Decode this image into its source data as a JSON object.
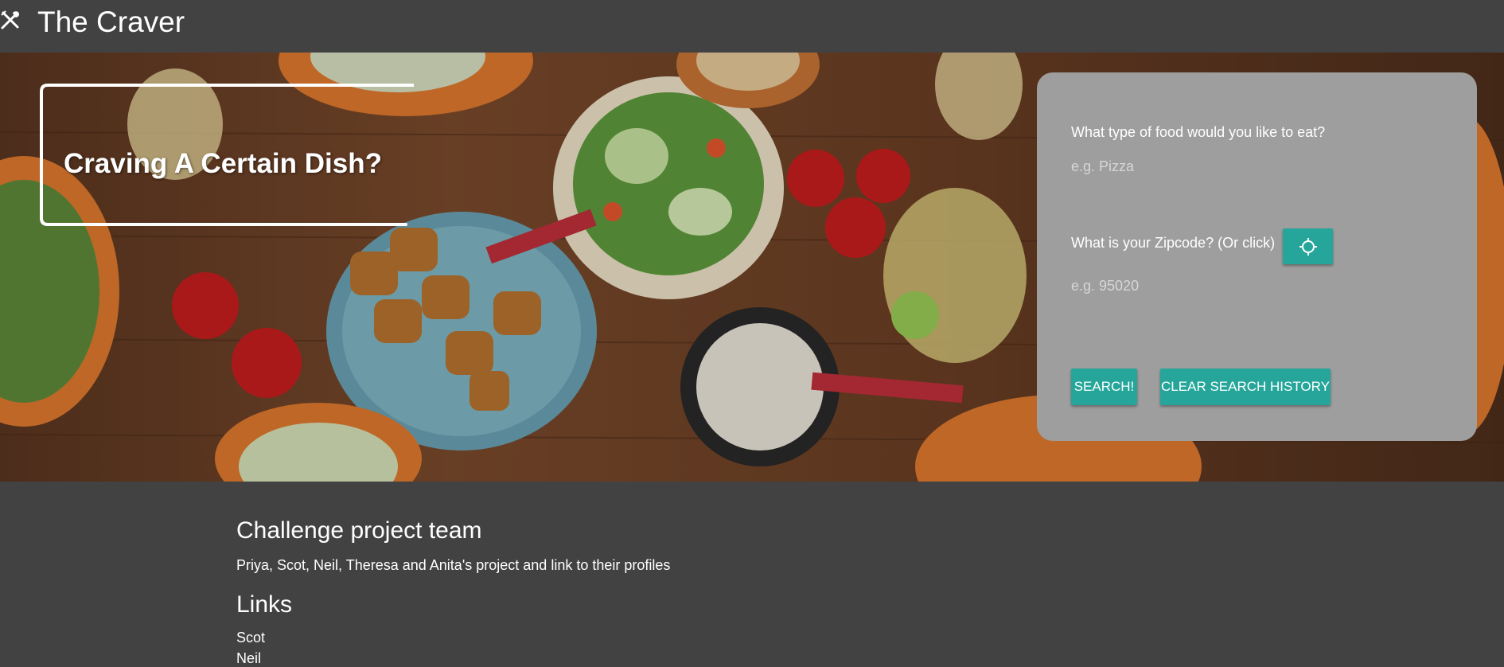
{
  "header": {
    "title": "The Craver",
    "icon": "utensils-icon"
  },
  "hero": {
    "heading": "Craving A Certain Dish?"
  },
  "search_form": {
    "food_label": "What type of food would you like to eat?",
    "food_placeholder": "e.g. Pizza",
    "zip_label": "What is your Zipcode? (Or click)",
    "zip_placeholder": "e.g. 95020",
    "locate_icon": "crosshair-icon",
    "search_label": "SEARCH!",
    "clear_label": "CLEAR SEARCH HISTORY"
  },
  "footer": {
    "team_title": "Challenge project team",
    "team_text": "Priya, Scot, Neil, Theresa and Anita's project and link to their profiles",
    "links_title": "Links",
    "links": [
      "Scot",
      "Neil"
    ]
  },
  "colors": {
    "background": "#424242",
    "card": "#9e9e9e",
    "accent": "#26a69a"
  }
}
